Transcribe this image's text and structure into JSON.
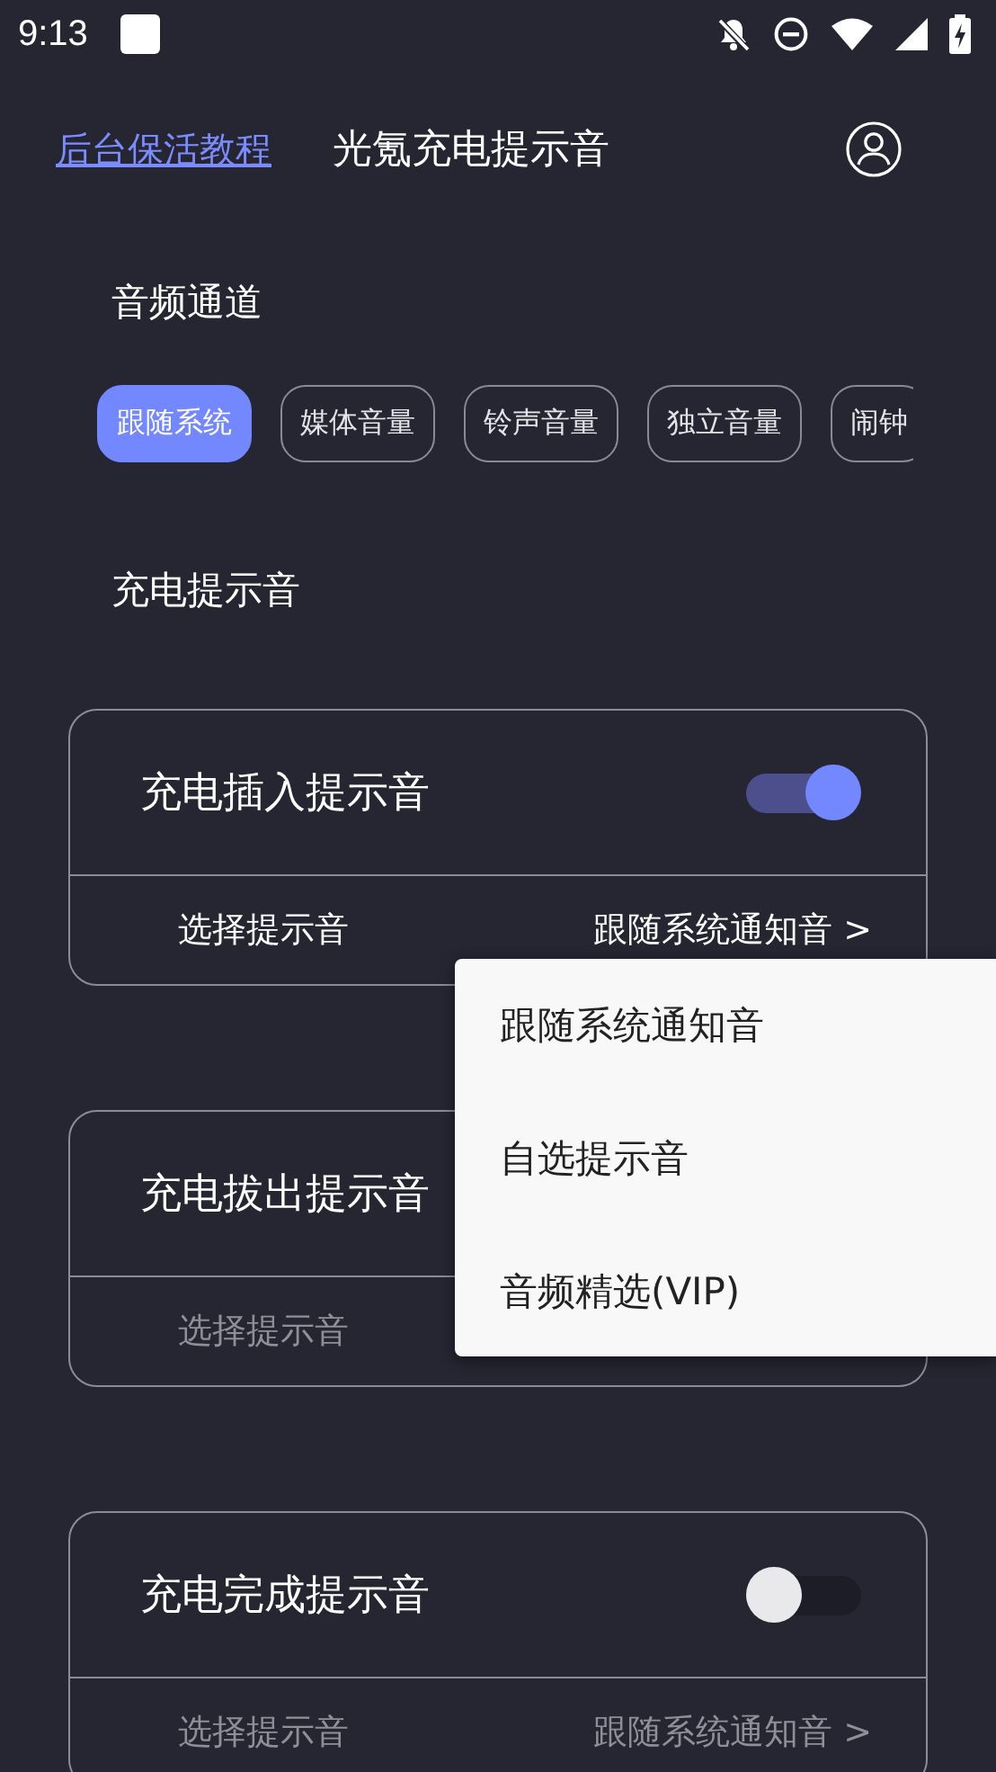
{
  "status_bar": {
    "time": "9:13"
  },
  "header": {
    "link": "后台保活教程",
    "title": "光氪充电提示音"
  },
  "channel_section": {
    "title": "音频通道",
    "chips": [
      {
        "label": "跟随系统",
        "selected": true
      },
      {
        "label": "媒体音量",
        "selected": false
      },
      {
        "label": "铃声音量",
        "selected": false
      },
      {
        "label": "独立音量",
        "selected": false
      },
      {
        "label": "闹钟",
        "selected": false
      }
    ]
  },
  "sound_section": {
    "title": "充电提示音",
    "cards": [
      {
        "kind": "toggle",
        "title": "充电插入提示音",
        "on": true,
        "row_label": "选择提示音",
        "row_value": "跟随系统通知音 >"
      },
      {
        "kind": "plain",
        "title": "充电拔出提示音",
        "on": false,
        "row_label": "选择提示音"
      },
      {
        "kind": "toggle",
        "title": "充电完成提示音",
        "on": false,
        "row_label": "选择提示音",
        "row_value": "跟随系统通知音 >"
      }
    ]
  },
  "menu": {
    "items": [
      "跟随系统通知音",
      "自选提示音",
      "音频精选(VIP)"
    ]
  }
}
